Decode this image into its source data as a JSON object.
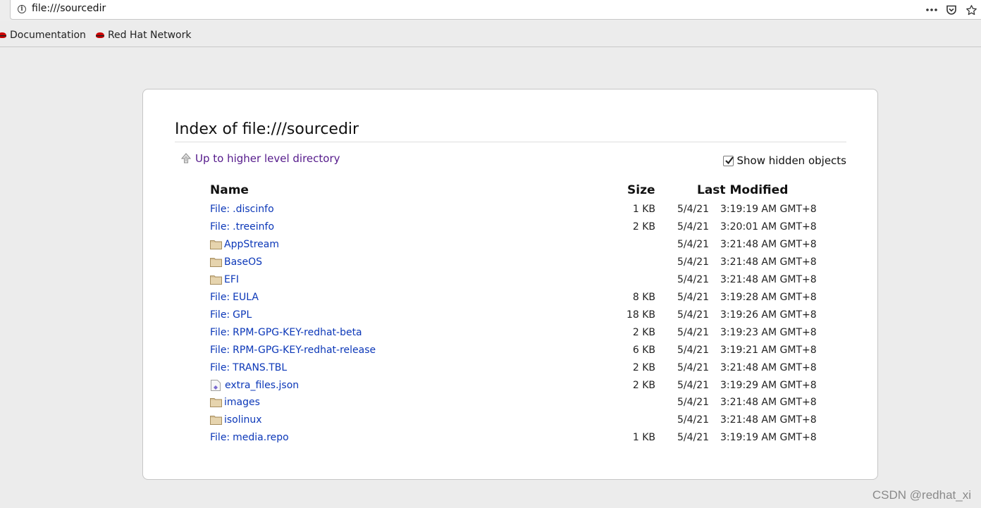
{
  "urlbar": {
    "url": "file:///sourcedir"
  },
  "bookmarks": [
    {
      "label": "Documentation",
      "icon": "redhat-icon"
    },
    {
      "label": "Red Hat Network",
      "icon": "redhat-icon"
    }
  ],
  "page": {
    "title": "Index of file:///sourcedir",
    "up_link": "Up to higher level directory",
    "show_hidden_label": "Show hidden objects",
    "show_hidden_checked": true
  },
  "table": {
    "headers": {
      "name": "Name",
      "size": "Size",
      "modified": "Last Modified"
    },
    "rows": [
      {
        "type": "file",
        "prefix": "File:",
        "name": ".discinfo",
        "size": "1 KB",
        "date": "5/4/21",
        "time": "3:19:19 AM GMT+8"
      },
      {
        "type": "file",
        "prefix": "File:",
        "name": ".treeinfo",
        "size": "2 KB",
        "date": "5/4/21",
        "time": "3:20:01 AM GMT+8"
      },
      {
        "type": "folder",
        "prefix": "",
        "name": "AppStream",
        "size": "",
        "date": "5/4/21",
        "time": "3:21:48 AM GMT+8"
      },
      {
        "type": "folder",
        "prefix": "",
        "name": "BaseOS",
        "size": "",
        "date": "5/4/21",
        "time": "3:21:48 AM GMT+8"
      },
      {
        "type": "folder",
        "prefix": "",
        "name": "EFI",
        "size": "",
        "date": "5/4/21",
        "time": "3:21:48 AM GMT+8"
      },
      {
        "type": "file",
        "prefix": "File:",
        "name": "EULA",
        "size": "8 KB",
        "date": "5/4/21",
        "time": "3:19:28 AM GMT+8"
      },
      {
        "type": "file",
        "prefix": "File:",
        "name": "GPL",
        "size": "18 KB",
        "date": "5/4/21",
        "time": "3:19:26 AM GMT+8"
      },
      {
        "type": "file",
        "prefix": "File:",
        "name": "RPM-GPG-KEY-redhat-beta",
        "size": "2 KB",
        "date": "5/4/21",
        "time": "3:19:23 AM GMT+8"
      },
      {
        "type": "file",
        "prefix": "File:",
        "name": "RPM-GPG-KEY-redhat-release",
        "size": "6 KB",
        "date": "5/4/21",
        "time": "3:19:21 AM GMT+8"
      },
      {
        "type": "file",
        "prefix": "File:",
        "name": "TRANS.TBL",
        "size": "2 KB",
        "date": "5/4/21",
        "time": "3:21:48 AM GMT+8"
      },
      {
        "type": "json",
        "prefix": "",
        "name": "extra_files.json",
        "size": "2 KB",
        "date": "5/4/21",
        "time": "3:19:29 AM GMT+8"
      },
      {
        "type": "folder",
        "prefix": "",
        "name": "images",
        "size": "",
        "date": "5/4/21",
        "time": "3:21:48 AM GMT+8"
      },
      {
        "type": "folder",
        "prefix": "",
        "name": "isolinux",
        "size": "",
        "date": "5/4/21",
        "time": "3:21:48 AM GMT+8"
      },
      {
        "type": "file",
        "prefix": "File:",
        "name": "media.repo",
        "size": "1 KB",
        "date": "5/4/21",
        "time": "3:19:19 AM GMT+8"
      }
    ]
  },
  "watermark": "CSDN @redhat_xi"
}
